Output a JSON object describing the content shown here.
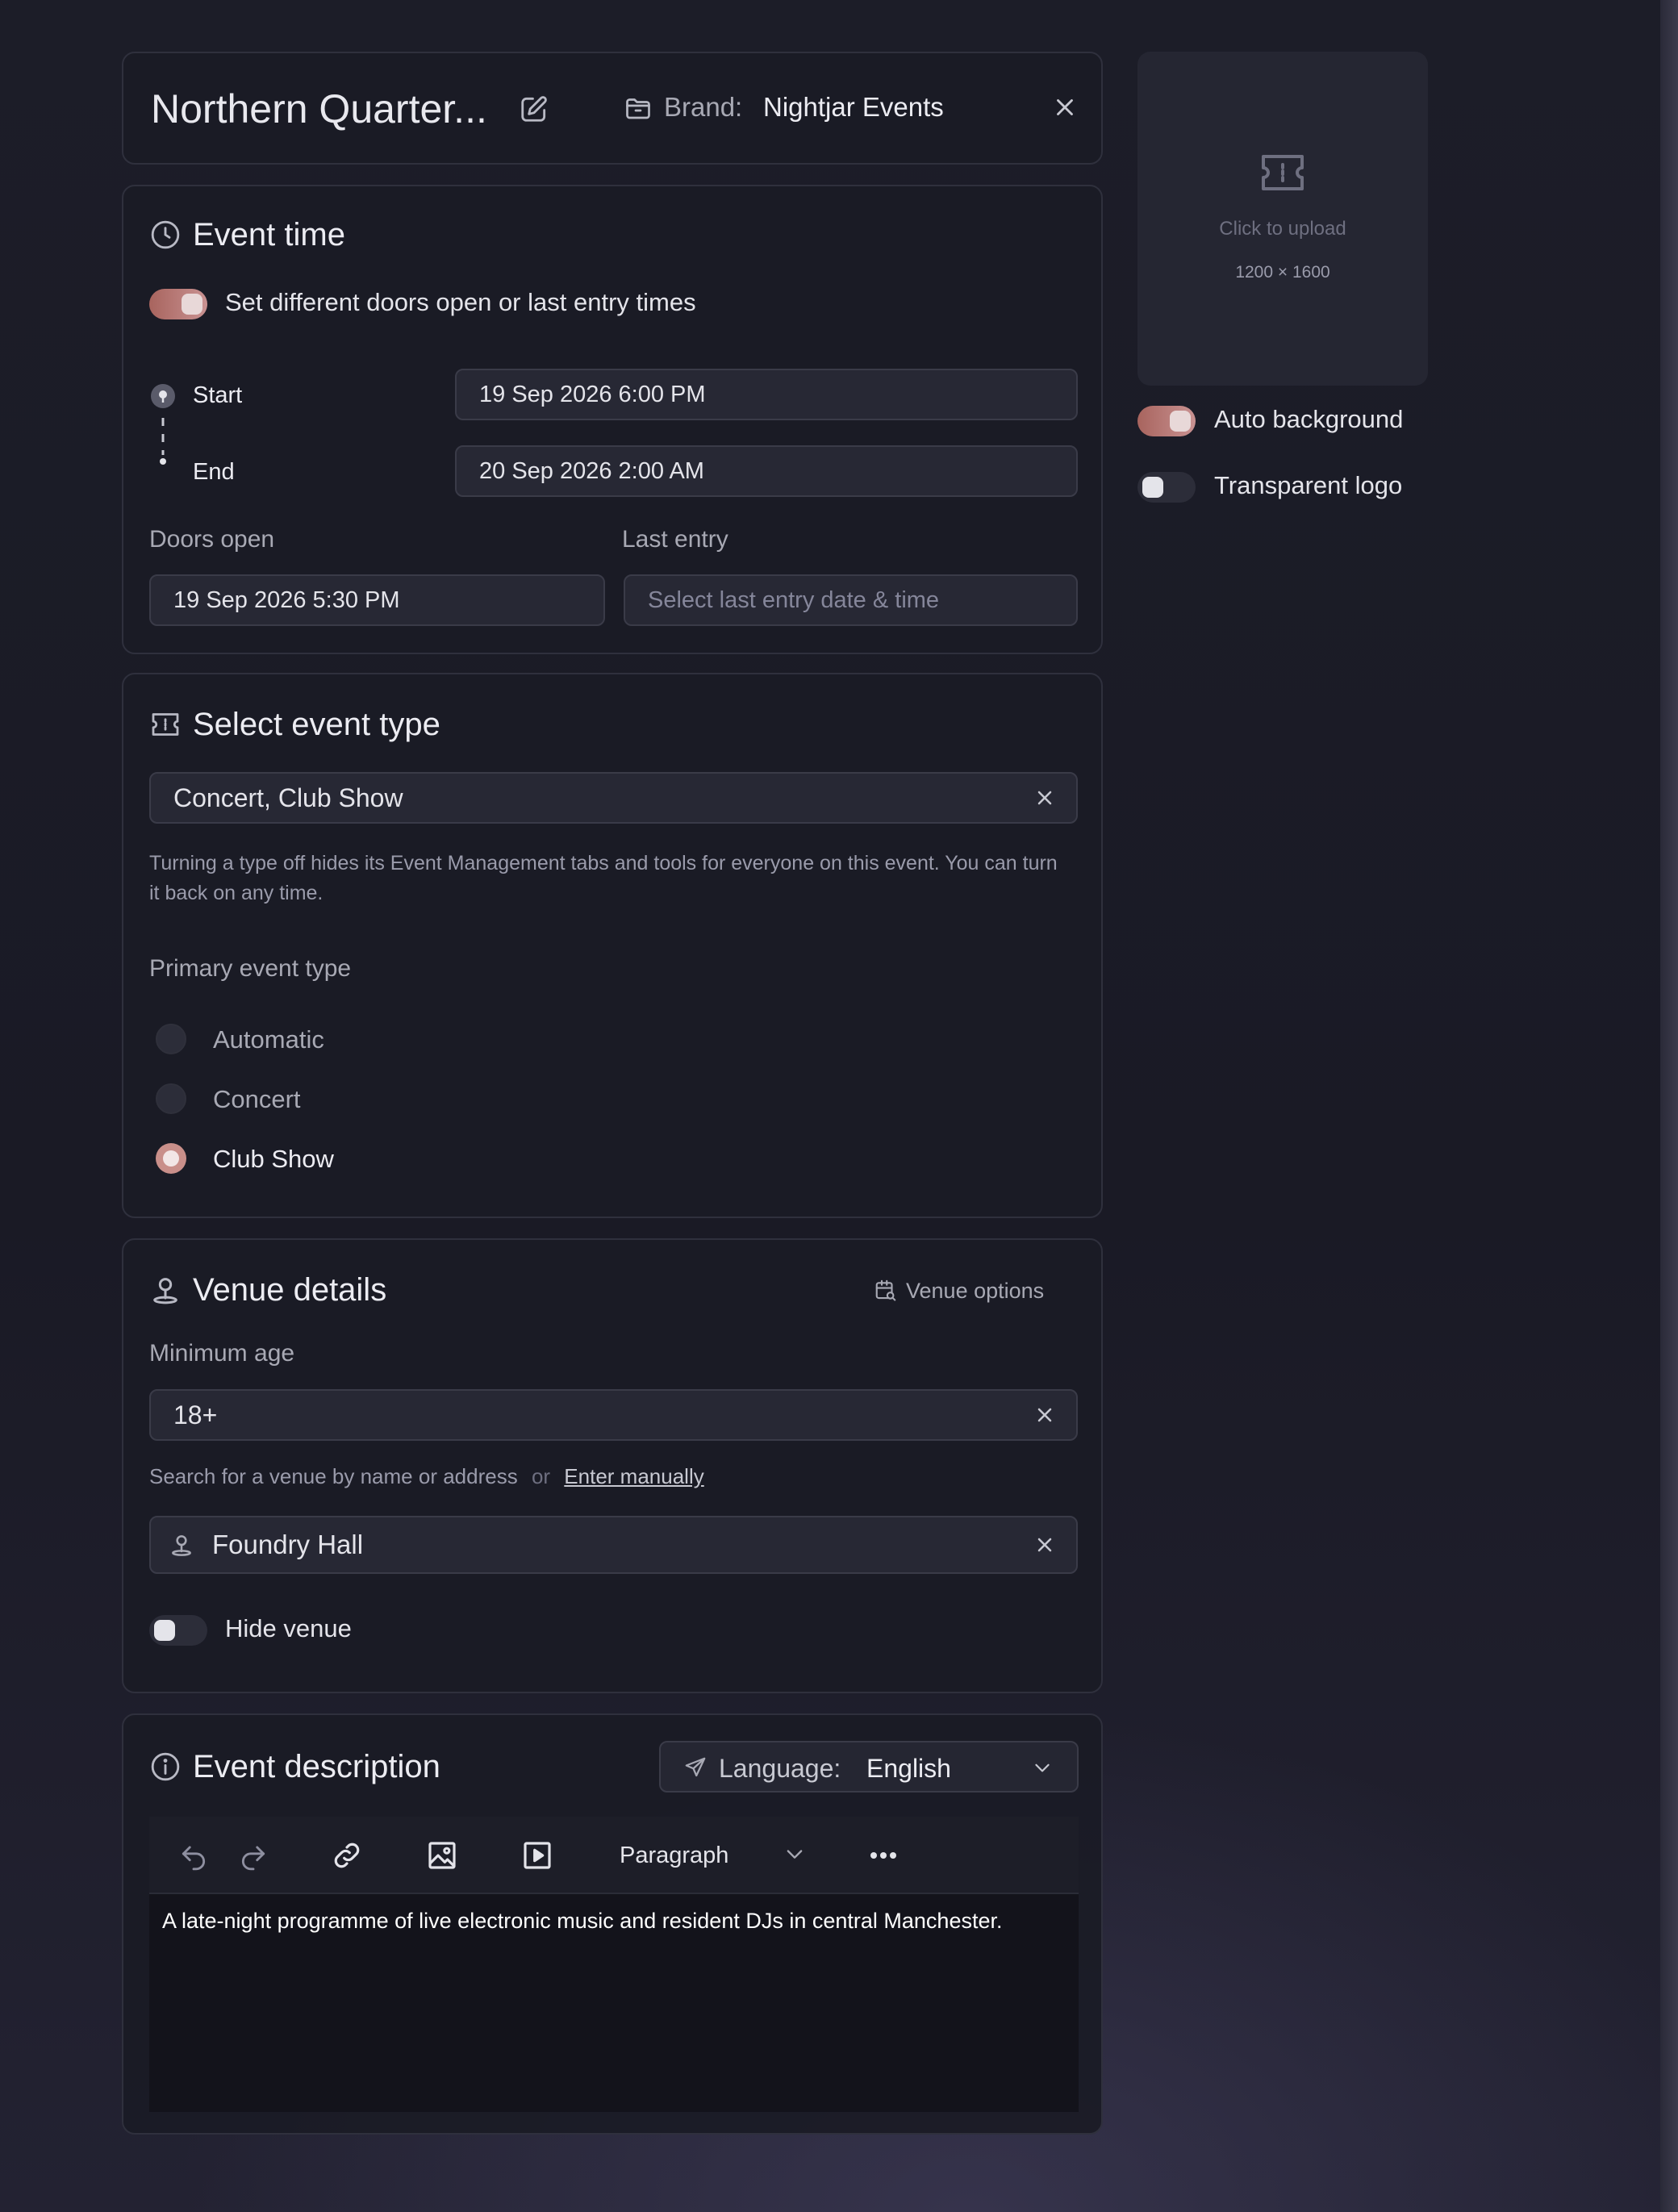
{
  "header": {
    "title": "Northern Quarter...",
    "brand_label": "Brand:",
    "brand_value": "Nightjar Events"
  },
  "upload": {
    "hint": "Click to upload",
    "dimensions": "1200 × 1600",
    "auto_background_label": "Auto background",
    "auto_background_on": true,
    "transparent_logo_label": "Transparent logo",
    "transparent_logo_on": false
  },
  "event_time": {
    "title": "Event time",
    "toggle_label": "Set different doors open or last entry times",
    "toggle_on": true,
    "start_label": "Start",
    "start_value": "19 Sep 2026 6:00 PM",
    "end_label": "End",
    "end_value": "20 Sep 2026 2:00 AM",
    "doors_open_label": "Doors open",
    "doors_open_value": "19 Sep 2026 5:30 PM",
    "last_entry_label": "Last entry",
    "last_entry_placeholder": "Select last entry date & time"
  },
  "event_type": {
    "title": "Select event type",
    "selected": "Concert, Club Show",
    "helper": "Turning a type off hides its Event Management tabs and tools for everyone on this event. You can turn it back on any time.",
    "primary_label": "Primary event type",
    "options": [
      "Automatic",
      "Concert",
      "Club Show"
    ],
    "primary_selected": "Club Show"
  },
  "venue": {
    "title": "Venue details",
    "options_label": "Venue options",
    "min_age_label": "Minimum age",
    "min_age_value": "18+",
    "search_hint": "Search for a venue by name or address",
    "or_text": "or",
    "enter_manually": "Enter manually",
    "venue_value": "Foundry Hall",
    "hide_venue_label": "Hide venue",
    "hide_venue_on": false
  },
  "description": {
    "title": "Event description",
    "language_label": "Language:",
    "language_value": "English",
    "block_format": "Paragraph",
    "text": "A late-night programme of live electronic music and resident DJs in central Manchester."
  },
  "colors": {
    "accent": "#c98f8a",
    "background": "#1c1d28",
    "card": "#1a1b25"
  }
}
